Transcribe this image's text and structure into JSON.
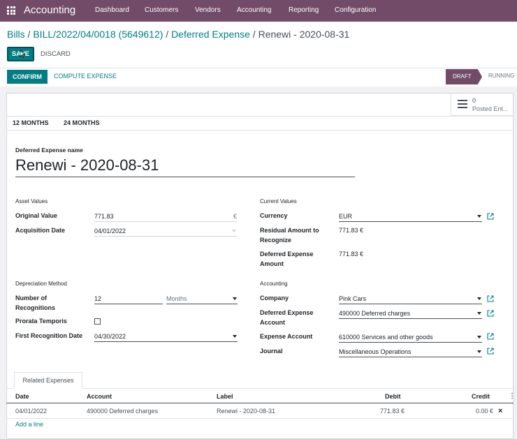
{
  "topbar": {
    "app_name": "Accounting",
    "menu": [
      "Dashboard",
      "Customers",
      "Vendors",
      "Accounting",
      "Reporting",
      "Configuration"
    ]
  },
  "breadcrumb": {
    "items": [
      "Bills",
      "BILL/2022/04/0018 (5649612)",
      "Deferred Expense"
    ],
    "current": "Renewi - 2020-08-31",
    "separator": " / "
  },
  "actions": {
    "save_label": "SAVE",
    "discard_label": "DISCARD",
    "confirm_label": "CONFIRM",
    "compute_label": "COMPUTE EXPENSE"
  },
  "statusbar": {
    "draft": "DRAFT",
    "running": "RUNNING"
  },
  "smart_button": {
    "count": "0",
    "label": "Posted Ent..."
  },
  "model_buttons": [
    "12 MONTHS",
    "24 MONTHS"
  ],
  "form": {
    "name_label": "Deferred Expense name",
    "name_value": "Renewi - 2020-08-31",
    "asset_values": {
      "title": "Asset Values",
      "original_value_label": "Original Value",
      "original_value": "771.83",
      "currency_symbol": "€",
      "acquisition_date_label": "Acquisition Date",
      "acquisition_date": "04/01/2022"
    },
    "depreciation": {
      "title": "Depreciation Method",
      "recognitions_label_1": "Number of",
      "recognitions_label_2": "Recognitions",
      "recognitions_value": "12",
      "period_value": "Months",
      "prorata_label": "Prorata Temporis",
      "prorata_checked": false,
      "first_date_label": "First Recognition Date",
      "first_date_value": "04/30/2022"
    },
    "current_values": {
      "title": "Current Values",
      "currency_label": "Currency",
      "currency_value": "EUR",
      "residual_label_1": "Residual Amount to",
      "residual_label_2": "Recognize",
      "residual_value": "771.83 €",
      "deferred_amount_label_1": "Deferred Expense",
      "deferred_amount_label_2": "Amount",
      "deferred_amount_value": "771.83 €"
    },
    "accounting": {
      "title": "Accounting",
      "company_label": "Company",
      "company_value": "Pink Cars",
      "deferred_account_label_1": "Deferred Expense",
      "deferred_account_label_2": "Account",
      "deferred_account_value": "490000 Deferred charges",
      "expense_account_label": "Expense Account",
      "expense_account_value": "610000 Services and other goods",
      "journal_label": "Journal",
      "journal_value": "Miscellaneous Operations"
    }
  },
  "related": {
    "tab_label": "Related Expenses",
    "columns": [
      "Date",
      "Account",
      "Label",
      "Debit",
      "Credit"
    ],
    "rows": [
      {
        "date": "04/01/2022",
        "account": "490000 Deferred charges",
        "label": "Renewi - 2020-08-31",
        "debit": "771.83 €",
        "credit": "0.00 €"
      }
    ],
    "add_line_label": "Add a line"
  },
  "colors": {
    "brand": "#714B67",
    "accent": "#017e84"
  }
}
